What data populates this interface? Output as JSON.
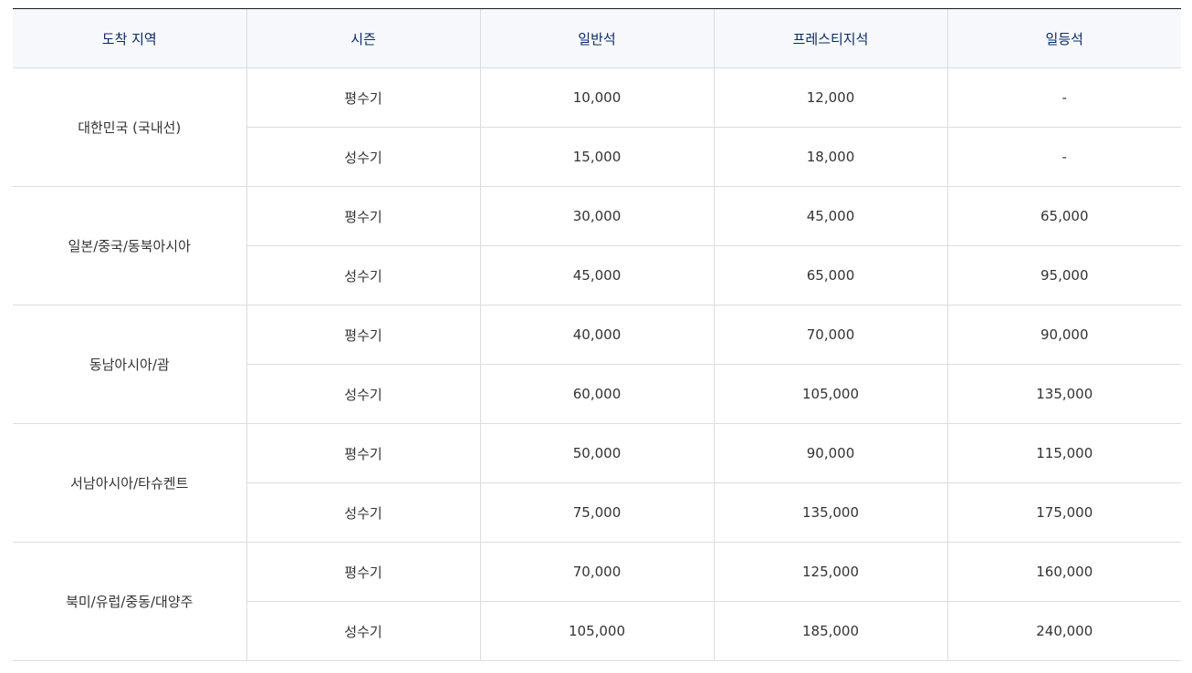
{
  "table": {
    "headers": [
      "도착 지역",
      "시즌",
      "일반석",
      "프레스티지석",
      "일등석"
    ],
    "groups": [
      {
        "region": "대한민국 (국내선)",
        "rows": [
          {
            "season": "평수기",
            "economy": "10,000",
            "prestige": "12,000",
            "first": "-"
          },
          {
            "season": "성수기",
            "economy": "15,000",
            "prestige": "18,000",
            "first": "-"
          }
        ]
      },
      {
        "region": "일본/중국/동북아시아",
        "rows": [
          {
            "season": "평수기",
            "economy": "30,000",
            "prestige": "45,000",
            "first": "65,000"
          },
          {
            "season": "성수기",
            "economy": "45,000",
            "prestige": "65,000",
            "first": "95,000"
          }
        ]
      },
      {
        "region": "동남아시아/괌",
        "rows": [
          {
            "season": "평수기",
            "economy": "40,000",
            "prestige": "70,000",
            "first": "90,000"
          },
          {
            "season": "성수기",
            "economy": "60,000",
            "prestige": "105,000",
            "first": "135,000"
          }
        ]
      },
      {
        "region": "서남아시아/타슈켄트",
        "rows": [
          {
            "season": "평수기",
            "economy": "50,000",
            "prestige": "90,000",
            "first": "115,000"
          },
          {
            "season": "성수기",
            "economy": "75,000",
            "prestige": "135,000",
            "first": "175,000"
          }
        ]
      },
      {
        "region": "북미/유럽/중동/대양주",
        "rows": [
          {
            "season": "평수기",
            "economy": "70,000",
            "prestige": "125,000",
            "first": "160,000"
          },
          {
            "season": "성수기",
            "economy": "105,000",
            "prestige": "185,000",
            "first": "240,000"
          }
        ]
      }
    ]
  },
  "colors": {
    "header_background": "#f6f8fc",
    "header_text": "#0a2a66",
    "body_text": "#333333",
    "grid_line": "#dcdcdc",
    "top_border": "#1a1a1a"
  }
}
